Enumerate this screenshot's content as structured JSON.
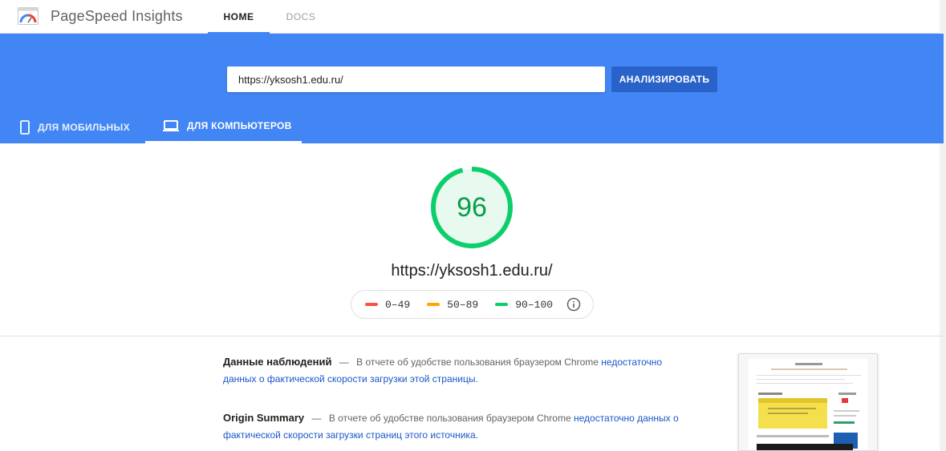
{
  "app": {
    "brand": "PageSpeed Insights",
    "nav": {
      "home": "HOME",
      "docs": "DOCS"
    }
  },
  "search": {
    "url": "https://yksosh1.edu.ru/",
    "analyze_label": "АНАЛИЗИРОВАТЬ"
  },
  "device_tabs": {
    "mobile": "ДЛЯ МОБИЛЬНЫХ",
    "desktop": "ДЛЯ КОМПЬЮТЕРОВ",
    "selected": "desktop"
  },
  "score": {
    "value": "96",
    "fraction": 0.96,
    "color": "#0cce6b",
    "result_url": "https://yksosh1.edu.ru/"
  },
  "legend": {
    "poor": {
      "range": "0–49",
      "color": "#ff4e42"
    },
    "average": {
      "range": "50–89",
      "color": "#ffa400"
    },
    "good": {
      "range": "90–100",
      "color": "#0cce6b"
    }
  },
  "field_data": {
    "label": "Данные наблюдений",
    "dash": "—",
    "text": "В отчете об удобстве пользования браузером Chrome",
    "link": "недостаточно данных о фактической скорости загрузки этой страницы."
  },
  "origin_summary": {
    "label": "Origin Summary",
    "dash": "—",
    "text": "В отчете об удобстве пользования браузером Chrome",
    "link": "недостаточно данных о фактической скорости загрузки страниц этого источника."
  },
  "colors": {
    "primary": "#4285f4",
    "button": "#2962c9",
    "link": "#1a57c7"
  }
}
